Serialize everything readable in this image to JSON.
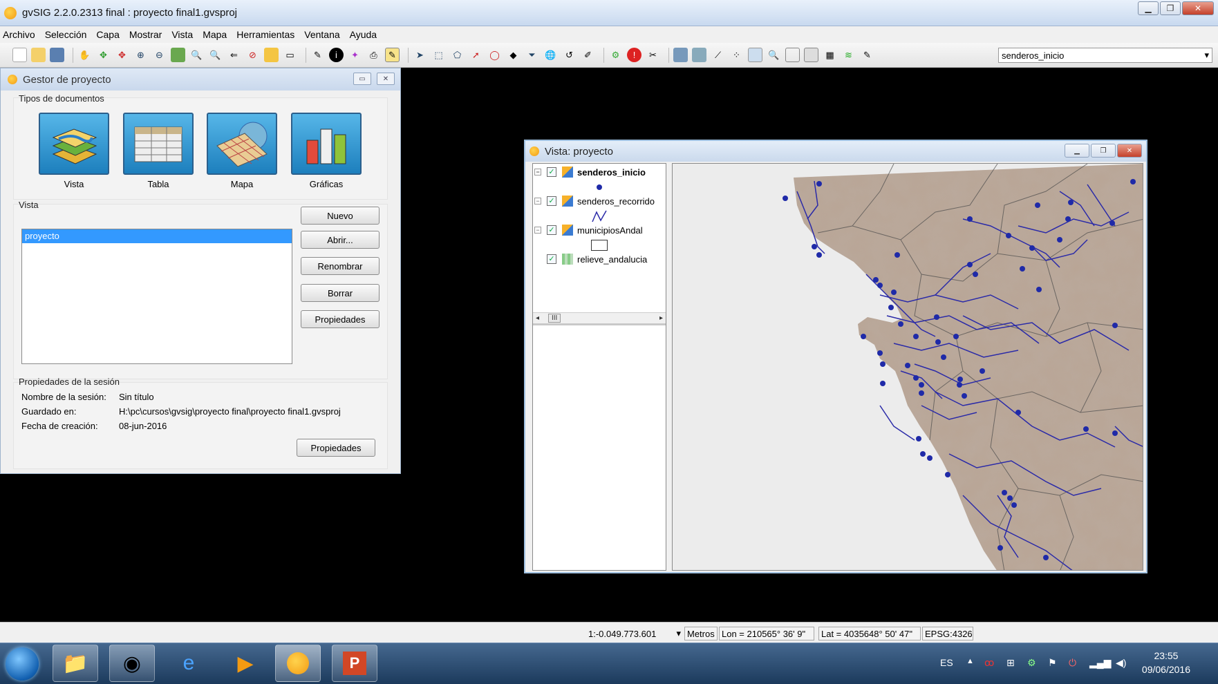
{
  "window": {
    "title": "gvSIG 2.2.0.2313 final : proyecto final1.gvsproj"
  },
  "menu": [
    "Archivo",
    "Selección",
    "Capa",
    "Mostrar",
    "Vista",
    "Mapa",
    "Herramientas",
    "Ventana",
    "Ayuda"
  ],
  "toolbar": {
    "layer_combo": "senderos_inicio"
  },
  "project_manager": {
    "title": "Gestor de proyecto",
    "doc_types_label": "Tipos de documentos",
    "doc_types": [
      {
        "label": "Vista",
        "icon": "layers-icon"
      },
      {
        "label": "Tabla",
        "icon": "table-icon"
      },
      {
        "label": "Mapa",
        "icon": "map-icon"
      },
      {
        "label": "Gráficas",
        "icon": "chart-icon"
      }
    ],
    "section_label": "Vista",
    "selected_item": "proyecto",
    "buttons": {
      "new": "Nuevo",
      "open": "Abrir...",
      "rename": "Renombrar",
      "delete": "Borrar",
      "properties": "Propiedades"
    },
    "session": {
      "label": "Propiedades de la sesión",
      "name_label": "Nombre de la sesión:",
      "name_value": "Sin título",
      "saved_label": "Guardado en:",
      "saved_value": "H:\\pc\\cursos\\gvsig\\proyecto final\\proyecto final1.gvsproj",
      "date_label": "Fecha de creación:",
      "date_value": "08-jun-2016",
      "properties_button": "Propiedades"
    }
  },
  "view_window": {
    "title": "Vista: proyecto",
    "layers": [
      {
        "name": "senderos_inicio",
        "checked": true,
        "bold": true
      },
      {
        "name": "senderos_recorrido",
        "checked": true,
        "bold": false
      },
      {
        "name": "municipiosAndal",
        "checked": true,
        "bold": false
      },
      {
        "name": "relieve_andalucia",
        "checked": true,
        "bold": false
      }
    ],
    "scroll_thumb": "III"
  },
  "status": {
    "scale": "1:-0.049.773.601",
    "units": "Metros",
    "lon": "Lon = 210565° 36' 9\"",
    "lat": "Lat = 4035648° 50' 47\"",
    "epsg": "EPSG:4326"
  },
  "taskbar": {
    "language": "ES",
    "time": "23:55",
    "date": "09/06/2016"
  },
  "colors": {
    "accent": "#3399ff",
    "route": "#2a2aa8",
    "terrain": "#b9a595"
  }
}
